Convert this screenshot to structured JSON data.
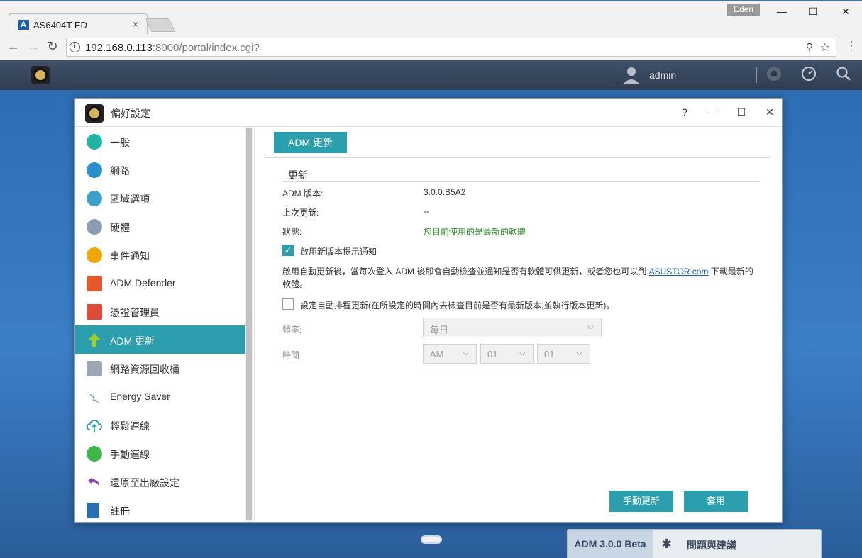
{
  "browser": {
    "tab_title": "AS6404T-ED",
    "tab_favicon": "asustor-favicon",
    "tab_close": "×",
    "window_user": "Eden",
    "minimize": "—",
    "maximize": "☐",
    "close": "✕",
    "url_host": "192.168.0.113",
    "url_rest": ":8000/portal/index.cgi?"
  },
  "adm_bar": {
    "username": "admin",
    "icons": [
      "preferences-icon",
      "user-icon",
      "notification-icon",
      "dashboard-icon",
      "search-icon"
    ]
  },
  "window": {
    "title": "偏好設定",
    "controls": {
      "help": "?",
      "minimize": "—",
      "maximize": "☐",
      "close": "✕"
    }
  },
  "sidebar": {
    "items": [
      {
        "label": "一般",
        "icon": "general-icon",
        "color": "#1fb3a4"
      },
      {
        "label": "網路",
        "icon": "network-globe-icon",
        "color": "#2a8ec9"
      },
      {
        "label": "區域選項",
        "icon": "region-icon",
        "color": "#3aa0c9"
      },
      {
        "label": "硬體",
        "icon": "hardware-icon",
        "color": "#8c9bb0"
      },
      {
        "label": "事件通知",
        "icon": "notification-icon",
        "color": "#f0a500"
      },
      {
        "label": "ADM Defender",
        "icon": "firewall-icon",
        "color": "#e8572a"
      },
      {
        "label": "憑證管理員",
        "icon": "certificate-icon",
        "color": "#e04a3a"
      },
      {
        "label": "ADM 更新",
        "icon": "update-arrow-icon",
        "color": "#9acd32"
      },
      {
        "label": "網路資源回收桶",
        "icon": "recycle-bin-icon",
        "color": "#9aa8b5"
      },
      {
        "label": "Energy Saver",
        "icon": "energy-icon",
        "color": "#35b05a"
      },
      {
        "label": "輕鬆連線",
        "icon": "cloud-upload-icon",
        "color": "#2b9fae"
      },
      {
        "label": "手動連線",
        "icon": "manual-connect-icon",
        "color": "#3cb54a"
      },
      {
        "label": "還原至出廠設定",
        "icon": "restore-icon",
        "color": "#8e44ad"
      },
      {
        "label": "註冊",
        "icon": "register-icon",
        "color": "#2a6fb0"
      }
    ],
    "active_index": 7
  },
  "content": {
    "tab_label": "ADM 更新",
    "section_title": "更新",
    "rows": [
      {
        "label": "ADM 版本:",
        "value": "3.0.0.B5A2"
      },
      {
        "label": "上次更新:",
        "value": "--"
      },
      {
        "label": "狀態:",
        "value": "您目前使用的是最新的軟體"
      }
    ],
    "notify_checkbox": {
      "label": "啟用新版本提示通知",
      "checked": true
    },
    "description_pre": "啟用自動更新後，當每次登入 ADM 後即會自動檢查並通知是否有軟體可供更新，或者您也可以到 ",
    "description_link": "ASUSTOR.com",
    "description_post": " 下載最新的軟體。",
    "schedule_checkbox": {
      "label": "設定自動排程更新(在所設定的時間內去檢查目前是否有最新版本,並執行版本更新)。",
      "checked": false
    },
    "frequency_label": "頻率:",
    "frequency_value": "每日",
    "time_label": "時間",
    "time_ampm": "AM",
    "time_hour": "01",
    "time_minute": "01",
    "manual_update_button": "手動更新",
    "apply_button": "套用"
  },
  "taskbar": {
    "version": "ADM 3.0.0 Beta",
    "feedback": "問題與建議"
  },
  "colors": {
    "accent": "#2b9fae",
    "status_ok": "#2e8b2e",
    "link": "#1a5fb4"
  }
}
